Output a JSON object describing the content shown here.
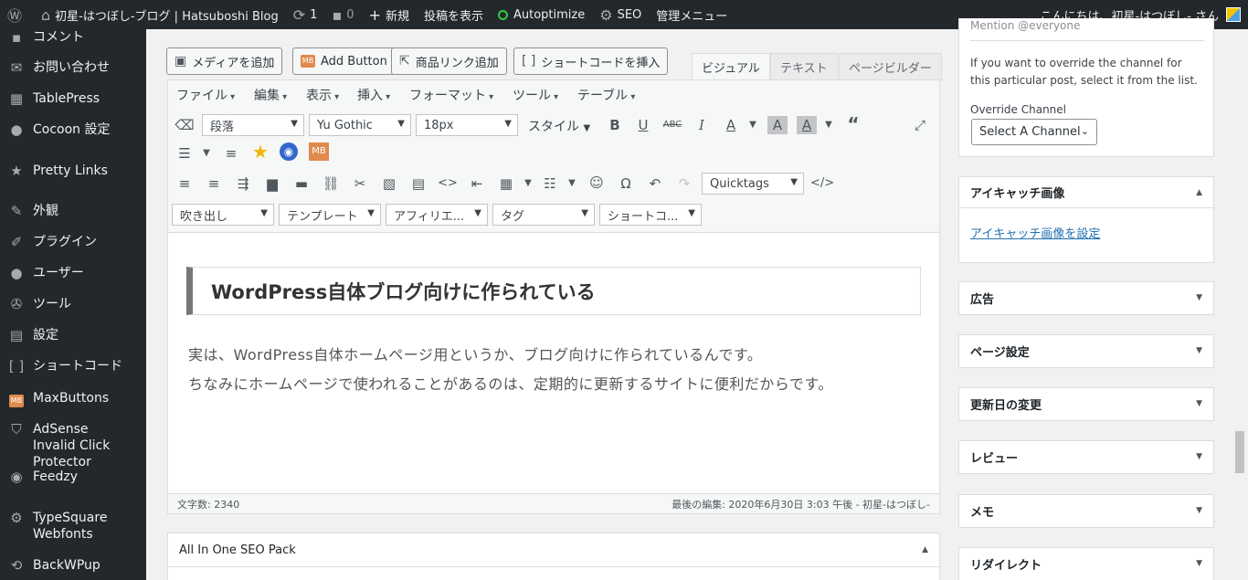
{
  "adminbar": {
    "site_name": "初星-はつぼし-ブログ | Hatsuboshi Blog",
    "updates_count": "1",
    "comments_count": "0",
    "new_label": "新規",
    "view_post": "投稿を表示",
    "autoptimize": "Autoptimize",
    "seo": "SEO",
    "admin_menu": "管理メニュー",
    "greeting": "こんにちは、初星-はつぼし- さん"
  },
  "sidebar": {
    "items": [
      {
        "label": "コメント",
        "icon": "comment-icon"
      },
      {
        "label": "お問い合わせ",
        "icon": "mail-icon"
      },
      {
        "label": "TablePress",
        "icon": "table-icon"
      },
      {
        "label": "Cocoon 設定",
        "icon": "dot-icon"
      },
      {
        "label": "Pretty Links",
        "icon": "star-icon"
      },
      {
        "label": "外観",
        "icon": "brush-icon"
      },
      {
        "label": "プラグイン",
        "icon": "plugin-icon"
      },
      {
        "label": "ユーザー",
        "icon": "user-icon"
      },
      {
        "label": "ツール",
        "icon": "wrench-icon"
      },
      {
        "label": "設定",
        "icon": "settings-icon"
      },
      {
        "label": "ショートコード",
        "icon": "bracket-icon"
      },
      {
        "label": "MaxButtons",
        "icon": "mb-icon"
      },
      {
        "label": "AdSense Invalid Click Protector",
        "icon": "shield-icon"
      },
      {
        "label": "Feedzy",
        "icon": "feed-icon"
      },
      {
        "label": "TypeSquare Webfonts",
        "icon": "gear-icon"
      },
      {
        "label": "BackWPup",
        "icon": "backup-icon"
      }
    ]
  },
  "media_buttons": {
    "add_media": "メディアを追加",
    "add_button": "Add Button",
    "product_link": "商品リンク追加",
    "shortcode": "ショートコードを挿入"
  },
  "editor_tabs": {
    "visual": "ビジュアル",
    "text": "テキスト",
    "page_builder": "ページビルダー"
  },
  "menubar": [
    "ファイル",
    "編集",
    "表示",
    "挿入",
    "フォーマット",
    "ツール",
    "テーブル"
  ],
  "toolbar": {
    "format": "段落",
    "font": "Yu Gothic",
    "size": "18px",
    "style": "スタイル",
    "quicktags": "Quicktags",
    "balloon": "吹き出し",
    "template": "テンプレート",
    "affiliate": "アフィリエ...",
    "tag": "タグ",
    "shortcode": "ショートコ..."
  },
  "content": {
    "heading": "WordPress自体ブログ向けに作られている",
    "para1": "実は、WordPress自体ホームページ用というか、ブログ向けに作られているんです。",
    "para2": "ちなみにホームページで使われることがあるのは、定期的に更新するサイトに便利だからです。"
  },
  "status": {
    "word_count": "文字数: 2340",
    "last_edit": "最後の編集: 2020年6月30日 3:03 午後 - 初星-はつぼし-"
  },
  "seo_box": {
    "title": "All In One SEO Pack"
  },
  "right": {
    "mention": "Mention @everyone",
    "override_text": "If you want to override the channel for this particular post, select it from the list.",
    "override_label": "Override Channel",
    "select_channel": "Select A Channel",
    "eyecatch_title": "アイキャッチ画像",
    "eyecatch_link": "アイキャッチ画像を設定",
    "boxes": [
      "広告",
      "ページ設定",
      "更新日の変更",
      "レビュー",
      "メモ",
      "リダイレクト"
    ]
  }
}
